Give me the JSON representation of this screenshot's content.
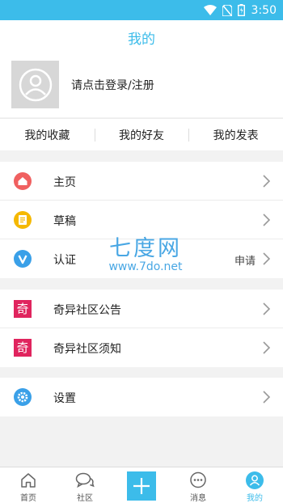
{
  "status_bar": {
    "time": "3:50"
  },
  "header": {
    "title": "我的"
  },
  "profile": {
    "login_text": "请点击登录/注册"
  },
  "quick_links": [
    {
      "label": "我的收藏"
    },
    {
      "label": "我的好友"
    },
    {
      "label": "我的发表"
    }
  ],
  "menu_group_1": [
    {
      "label": "主页",
      "icon": "home-icon",
      "color": "#f06060"
    },
    {
      "label": "草稿",
      "icon": "draft-icon",
      "color": "#f5b800"
    },
    {
      "label": "认证",
      "icon": "verify-icon",
      "color": "#3aa0e8",
      "right": "申请"
    }
  ],
  "menu_group_2": [
    {
      "label": "奇异社区公告",
      "icon": "qi-icon",
      "color": "#e0245e",
      "glyph": "奇"
    },
    {
      "label": "奇异社区须知",
      "icon": "qi-icon",
      "color": "#e0245e",
      "glyph": "奇"
    }
  ],
  "menu_group_3": [
    {
      "label": "设置",
      "icon": "settings-icon",
      "color": "#3aa0e8"
    }
  ],
  "watermark": {
    "big": "七度网",
    "small": "www.7do.net"
  },
  "tabs": [
    {
      "label": "首页",
      "icon": "home-tab-icon"
    },
    {
      "label": "社区",
      "icon": "community-icon"
    },
    {
      "label": "",
      "icon": "plus-icon"
    },
    {
      "label": "消息",
      "icon": "message-icon"
    },
    {
      "label": "我的",
      "icon": "profile-icon",
      "active": true
    }
  ],
  "colors": {
    "accent": "#3cbcea"
  }
}
